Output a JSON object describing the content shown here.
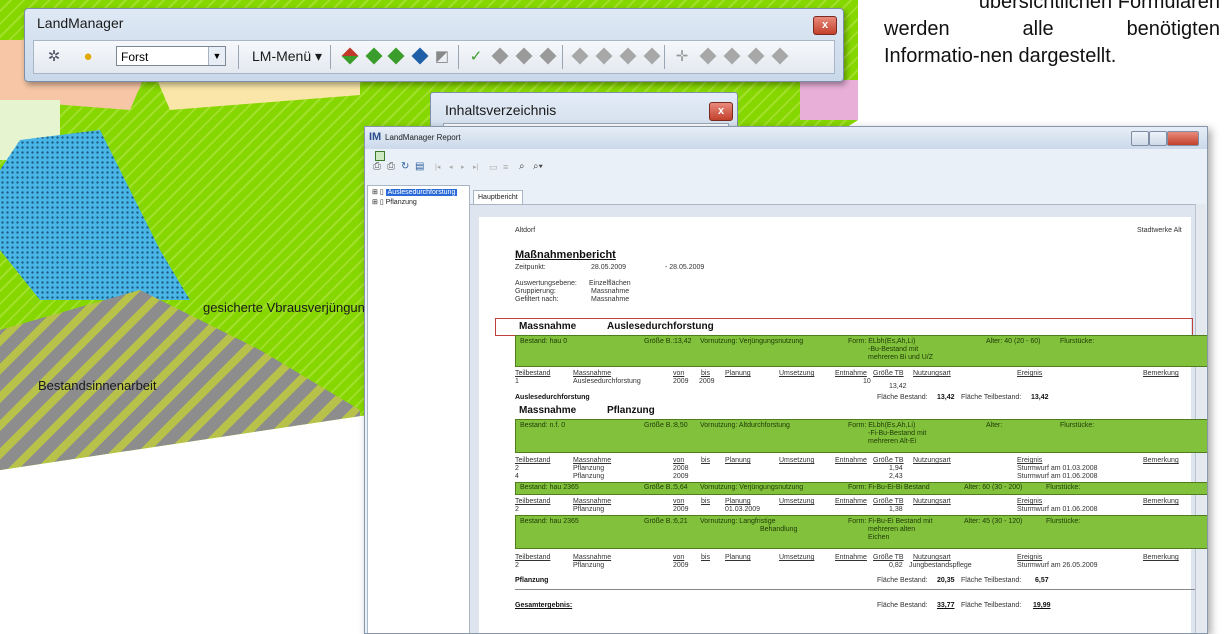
{
  "doc_text": {
    "line1": "übersichtlichen Formularen",
    "line2_left": "werden",
    "line2_mid": "alle",
    "line2_right": "benötigten",
    "line3": "Informatio-nen dargestellt."
  },
  "map": {
    "label_verjuengung": "gesicherte Vbrausverjüngung",
    "label_innenarbeit": "Bestandsinnenarbeit"
  },
  "lm_window": {
    "title": "LandManager",
    "close": "x",
    "select_value": "Forst",
    "menu_label": "LM-Menü ▾"
  },
  "ihv_window": {
    "title": "Inhaltsverzeichnis",
    "close": "x"
  },
  "report_window": {
    "title": "LandManager Report",
    "tree": [
      "Auslesedurchforstung",
      "Pflanzung"
    ],
    "tab": "Hauptbericht",
    "page": {
      "header_left": "Altdorf",
      "header_right": "Stadtwerke Alt",
      "report_title": "Maßnahmenbericht",
      "zeitpunkt_label": "Zeitpunkt:",
      "zeitpunkt_from": "28.05.2009",
      "zeitpunkt_to": "- 28.05.2009",
      "meta": [
        {
          "label": "Auswertungsebene:",
          "value": "Einzelflächen"
        },
        {
          "label": "Gruppierung:",
          "value": "Massnahme"
        },
        {
          "label": "Gefiltert nach:",
          "value": "Massnahme"
        }
      ],
      "massnahme_label": "Massnahme",
      "section1_title": "Auslesedurchforstung",
      "band1": {
        "bestand": "Bestand: hau 0",
        "groesse": "Größe B.:",
        "groesse_val": "13,42",
        "vornutzung": "Vornutzung: Verjüngungsnutzung",
        "form": "Form: ELbh(Es,Ah,Li)",
        "form2": "-Bu-Bestand mit",
        "form3": "mehreren Bi und U/Z",
        "alter": "Alter: 40 (20 - 60)",
        "flur": "Flurstücke:"
      },
      "cols": [
        "Teilbestand",
        "Massnahme",
        "von",
        "bis",
        "Planung",
        "Umsetzung",
        "Entnahme",
        "Größe TB",
        "Nutzungsart",
        "Ereignis",
        "Bemerkung"
      ],
      "row1": {
        "tb": "1",
        "m": "Auslesedurchforstung",
        "von": "2009",
        "bis": "2009",
        "entn": "10",
        "gr": "13,42"
      },
      "sum1": {
        "label": "Auslesedurchforstung",
        "fb_label": "Fläche Bestand:",
        "fb": "13,42",
        "ft_label": "Fläche Teilbestand:",
        "ft": "13,42"
      },
      "section2_title": "Pflanzung",
      "band2": {
        "bestand": "Bestand: n.f. 0",
        "groesse": "Größe B.:",
        "groesse_val": "8,50",
        "vornutzung": "Vornutzung: Altdurchforstung",
        "form": "Form: ELbh(Es,Ah,Li)",
        "form2": "-Fi-Bu-Bestand mit",
        "form3": "mehreren Alt-Ei",
        "alter": "Alter:",
        "flur": "Flurstücke:"
      },
      "rows2": [
        {
          "tb": "2",
          "m": "Pflanzung",
          "von": "2008",
          "gr": "1,94",
          "ereignis": "Sturmwurf am 01.03.2008"
        },
        {
          "tb": "4",
          "m": "Pflanzung",
          "von": "2009",
          "gr": "2,43",
          "ereignis": "Sturmwurf am 01.06.2008"
        }
      ],
      "band3": {
        "bestand": "Bestand: hau 2365",
        "groesse": "Größe B.:",
        "groesse_val": "5,64",
        "vornutzung": "Vornutzung: Verjüngungsnutzung",
        "form": "Form: Fi-Bu-Ei-Bi Bestand",
        "alter": "Alter: 60 (30 - 200)",
        "flur": "Flurstücke:"
      },
      "row3": {
        "tb": "2",
        "m": "Pflanzung",
        "von": "2009",
        "planung": "01.03.2009",
        "gr": "1,38",
        "ereignis": "Sturmwurf am 01.06.2008"
      },
      "band4": {
        "bestand": "Bestand: hau 2365",
        "groesse": "Größe B.:",
        "groesse_val": "6,21",
        "vornutzung": "Vornutzung: Langfristige",
        "vornutzung2": "Behandlung",
        "form": "Form: Fi-Bu-Ei Bestand mit",
        "form2": "mehreren alten",
        "form3": "Eichen",
        "alter": "Alter: 45 (30 - 120)",
        "flur": "Flurstücke:"
      },
      "row4": {
        "tb": "2",
        "m": "Pflanzung",
        "von": "2009",
        "gr": "0,82",
        "nutz": "Jungbestandspflege",
        "ereignis": "Sturmwurf am 26.05.2009"
      },
      "sum2": {
        "label": "Pflanzung",
        "fb_label": "Fläche Bestand:",
        "fb": "20,35",
        "ft_label": "Fläche Teilbestand:",
        "ft": "6,57"
      },
      "total": {
        "label": "Gesamtergebnis:",
        "fb_label": "Fläche Bestand:",
        "fb": "33,77",
        "ft_label": "Fläche Teilbestand:",
        "ft": "19,99"
      }
    }
  },
  "colors": {
    "map_green": "#7fd000",
    "band_green": "#82c13b",
    "window_frame": "#cbd9ea",
    "close_red": "#c2412c"
  }
}
